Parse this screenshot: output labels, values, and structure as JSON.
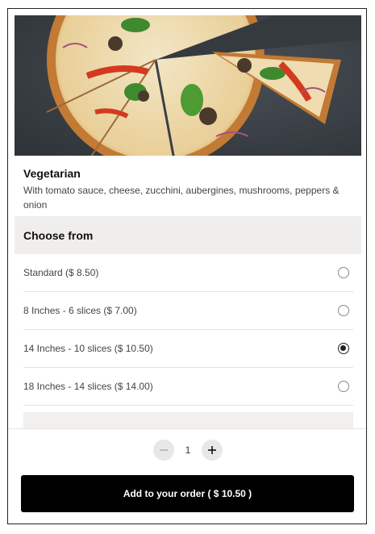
{
  "product": {
    "title": "Vegetarian",
    "description": "With tomato sauce, cheese, zucchini, aubergines, mushrooms, peppers & onion",
    "image_icon": "pizza-photo"
  },
  "section": {
    "heading": "Choose from"
  },
  "options": [
    {
      "label": "Standard ($ 8.50)",
      "selected": false
    },
    {
      "label": "8 Inches - 6 slices ($ 7.00)",
      "selected": false
    },
    {
      "label": "14 Inches - 10 slices ($ 10.50)",
      "selected": true
    },
    {
      "label": "18 Inches - 14 slices ($ 14.00)",
      "selected": false
    }
  ],
  "quantity": {
    "value": "1",
    "minus_icon": "minus-icon",
    "plus_icon": "plus-icon"
  },
  "cta": {
    "label": "Add to your order ( $ 10.50 )"
  },
  "colors": {
    "cta_background": "#000000",
    "section_background": "#efeeec"
  }
}
